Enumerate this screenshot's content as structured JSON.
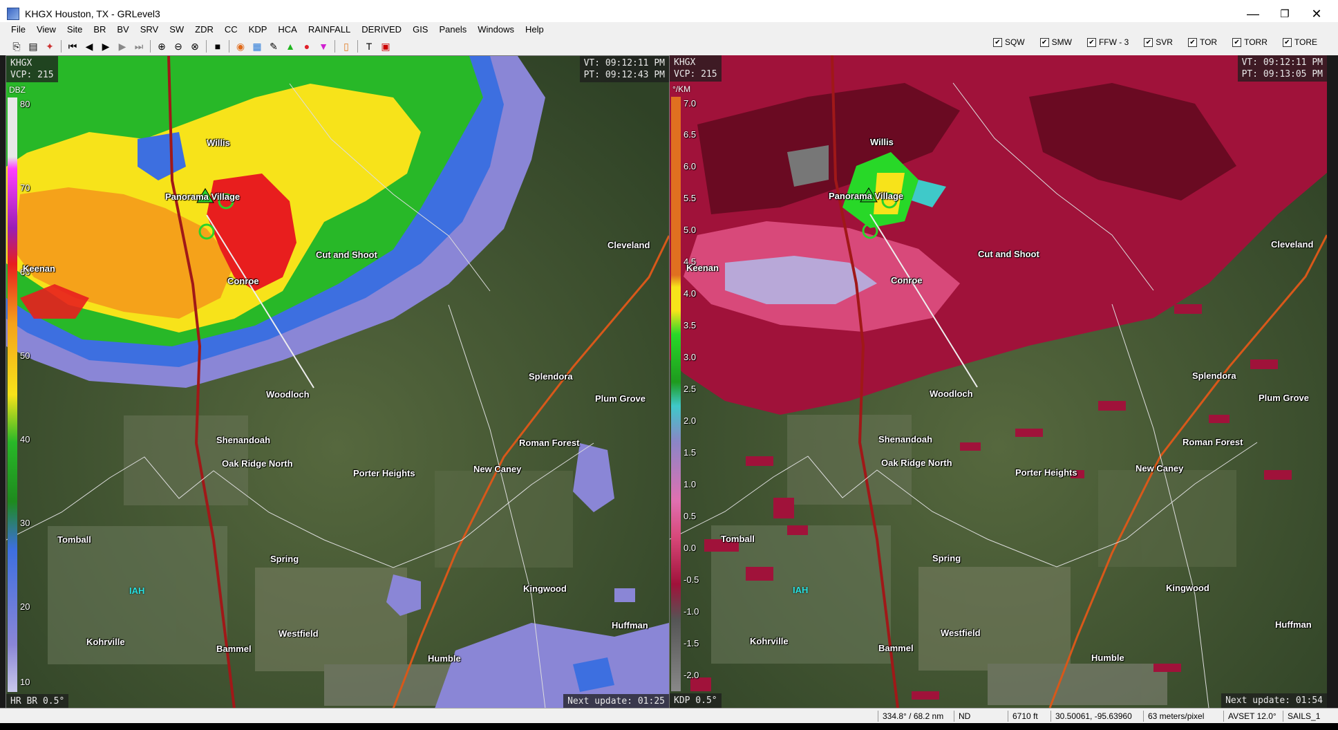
{
  "window": {
    "title": "KHGX Houston, TX - GRLevel3",
    "minimize": "—",
    "maximize": "❐",
    "close": "✕"
  },
  "menu": [
    "File",
    "View",
    "Site",
    "BR",
    "BV",
    "SRV",
    "SW",
    "ZDR",
    "CC",
    "KDP",
    "HCA",
    "RAINFALL",
    "DERIVED",
    "GIS",
    "Panels",
    "Windows",
    "Help"
  ],
  "warnings": [
    {
      "label": "SQW",
      "checked": true
    },
    {
      "label": "SMW",
      "checked": true
    },
    {
      "label": "FFW - 3",
      "checked": true
    },
    {
      "label": "SVR",
      "checked": true
    },
    {
      "label": "TOR",
      "checked": true
    },
    {
      "label": "TORR",
      "checked": true
    },
    {
      "label": "TORE",
      "checked": true
    }
  ],
  "left_panel": {
    "site": "KHGX",
    "vcp": "VCP: 215",
    "vt": "VT: 09:12:11 PM",
    "pt": "PT: 09:12:43 PM",
    "unit": "DBZ",
    "ticks": [
      "80",
      "70",
      "60",
      "50",
      "40",
      "30",
      "20",
      "10"
    ],
    "product": "HR BR 0.5°",
    "next_update": "Next update: 01:25"
  },
  "right_panel": {
    "site": "KHGX",
    "vcp": "VCP: 215",
    "vt": "VT: 09:12:11 PM",
    "pt": "PT: 09:13:05 PM",
    "unit": "°/KM",
    "ticks": [
      "7.0",
      "6.5",
      "6.0",
      "5.5",
      "5.0",
      "4.5",
      "4.0",
      "3.5",
      "3.0",
      "2.5",
      "2.0",
      "1.5",
      "1.0",
      "0.5",
      "0.0",
      "-0.5",
      "-1.0",
      "-1.5",
      "-2.0"
    ],
    "product": "KDP 0.5°",
    "next_update": "Next update: 01:54"
  },
  "places": {
    "willis": "Willis",
    "panorama": "Panorama Village",
    "cut_and_shoot": "Cut and Shoot",
    "keenan": "Keenan",
    "conroe": "Conroe",
    "cleveland": "Cleveland",
    "splendora": "Splendora",
    "plum_grove": "Plum Grove",
    "woodloch": "Woodloch",
    "shenandoah": "Shenandoah",
    "oak_ridge": "Oak Ridge North",
    "roman_forest": "Roman Forest",
    "porter_heights": "Porter Heights",
    "new_caney": "New Caney",
    "tomball": "Tomball",
    "spring": "Spring",
    "kingwood": "Kingwood",
    "iah": "IAH",
    "kohrville": "Kohrville",
    "westfield": "Westfield",
    "bammel": "Bammel",
    "humble": "Humble",
    "huffman": "Huffman"
  },
  "status": {
    "bearing": "334.8° / 68.2 nm",
    "value": "ND",
    "height": "6710 ft",
    "latlon": "30.50061, -95.63960",
    "res": "63 meters/pixel",
    "avset": "AVSET 12.0°",
    "sails": "SAILS_1"
  }
}
